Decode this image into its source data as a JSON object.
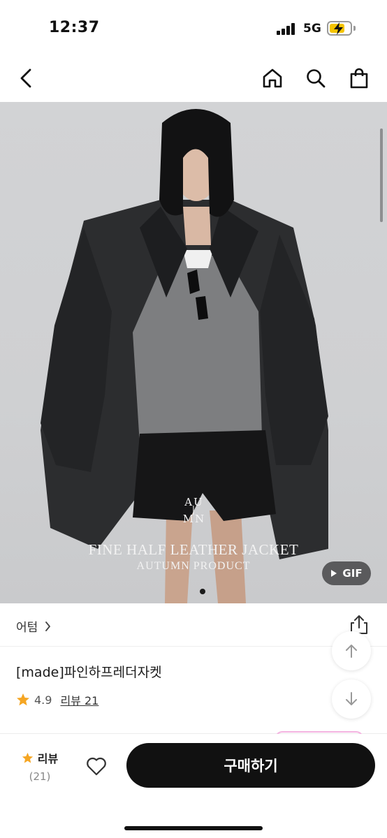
{
  "status_bar": {
    "time": "12:37",
    "network": "5G",
    "battery_color": "#f5c400"
  },
  "nav": {
    "back_icon": "chevron-left-icon",
    "home_icon": "home-icon",
    "search_icon": "search-icon",
    "bag_icon": "shopping-bag-icon"
  },
  "hero": {
    "logo_line1": "AU",
    "logo_line2": "MN",
    "title": "FINE HALF LEATHER JACKET",
    "subtitle": "AUTUMN PRODUCT",
    "gif_label": "GIF",
    "current_image_index": 1
  },
  "product": {
    "category": "어텀",
    "name": "[made]파인하프레더자켓",
    "rating": "4.9",
    "review_link": "리뷰 21",
    "star_color": "#f5a623"
  },
  "bottom_bar": {
    "review_label": "리뷰",
    "review_count": "(21)",
    "buy_label": "구매하기",
    "buy_color": "#111111"
  }
}
